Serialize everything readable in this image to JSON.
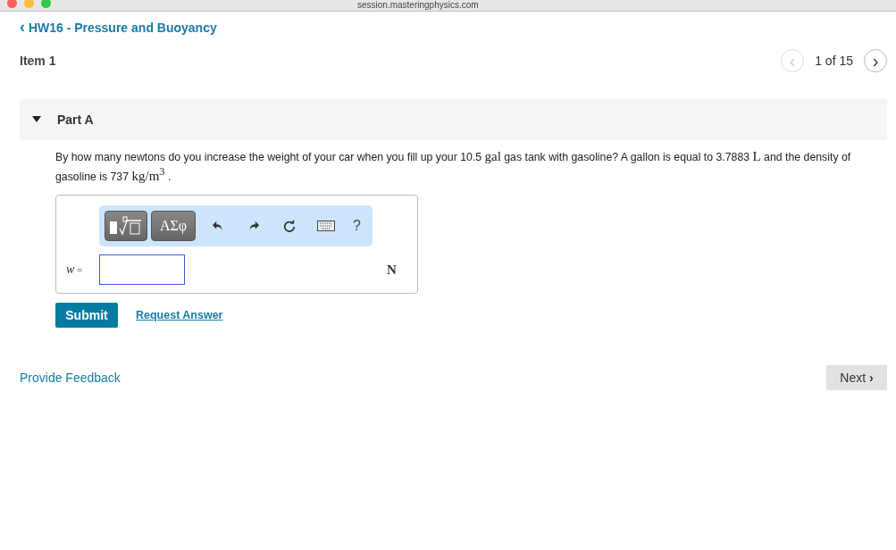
{
  "browser": {
    "address": "session.masteringphysics.com"
  },
  "breadcrumb": {
    "arrow": "‹",
    "label": "HW16 - Pressure and Buoyancy"
  },
  "item": {
    "title": "Item 1",
    "pager": {
      "previous": {
        "glyph": "‹",
        "disabled": true
      },
      "position": "1 of 15",
      "next": {
        "glyph": "›",
        "disabled": false
      }
    }
  },
  "part": {
    "title": "Part A",
    "expanded": true,
    "question": [
      {
        "kind": "text",
        "text": "By how many newtons do you increase the weight of your car when you fill up your 10.5 "
      },
      {
        "kind": "math",
        "text": "gal"
      },
      {
        "kind": "text",
        "text": " gas tank with gasoline? A gallon is equal to 3.7883 "
      },
      {
        "kind": "math",
        "text": "L"
      },
      {
        "kind": "text",
        "text": " and the density of gasoline is 737 "
      },
      {
        "kind": "math",
        "text": "kg/m$^{3}$"
      },
      {
        "kind": "text",
        "text": " ."
      }
    ],
    "toolbar": [
      {
        "kind": "templates"
      },
      {
        "kind": "symbols",
        "label": "ΑΣφ"
      },
      {
        "kind": "undo"
      },
      {
        "kind": "redo"
      },
      {
        "kind": "reset"
      },
      {
        "kind": "keyboard"
      },
      {
        "kind": "help",
        "label": "?"
      }
    ],
    "answer": {
      "variable": "w",
      "equals": "=",
      "unit": "N"
    },
    "submit": "Submit",
    "request": "Request Answer"
  },
  "footer": {
    "feedback": "Provide Feedback",
    "next": "Next",
    "next_glyph": "›"
  }
}
